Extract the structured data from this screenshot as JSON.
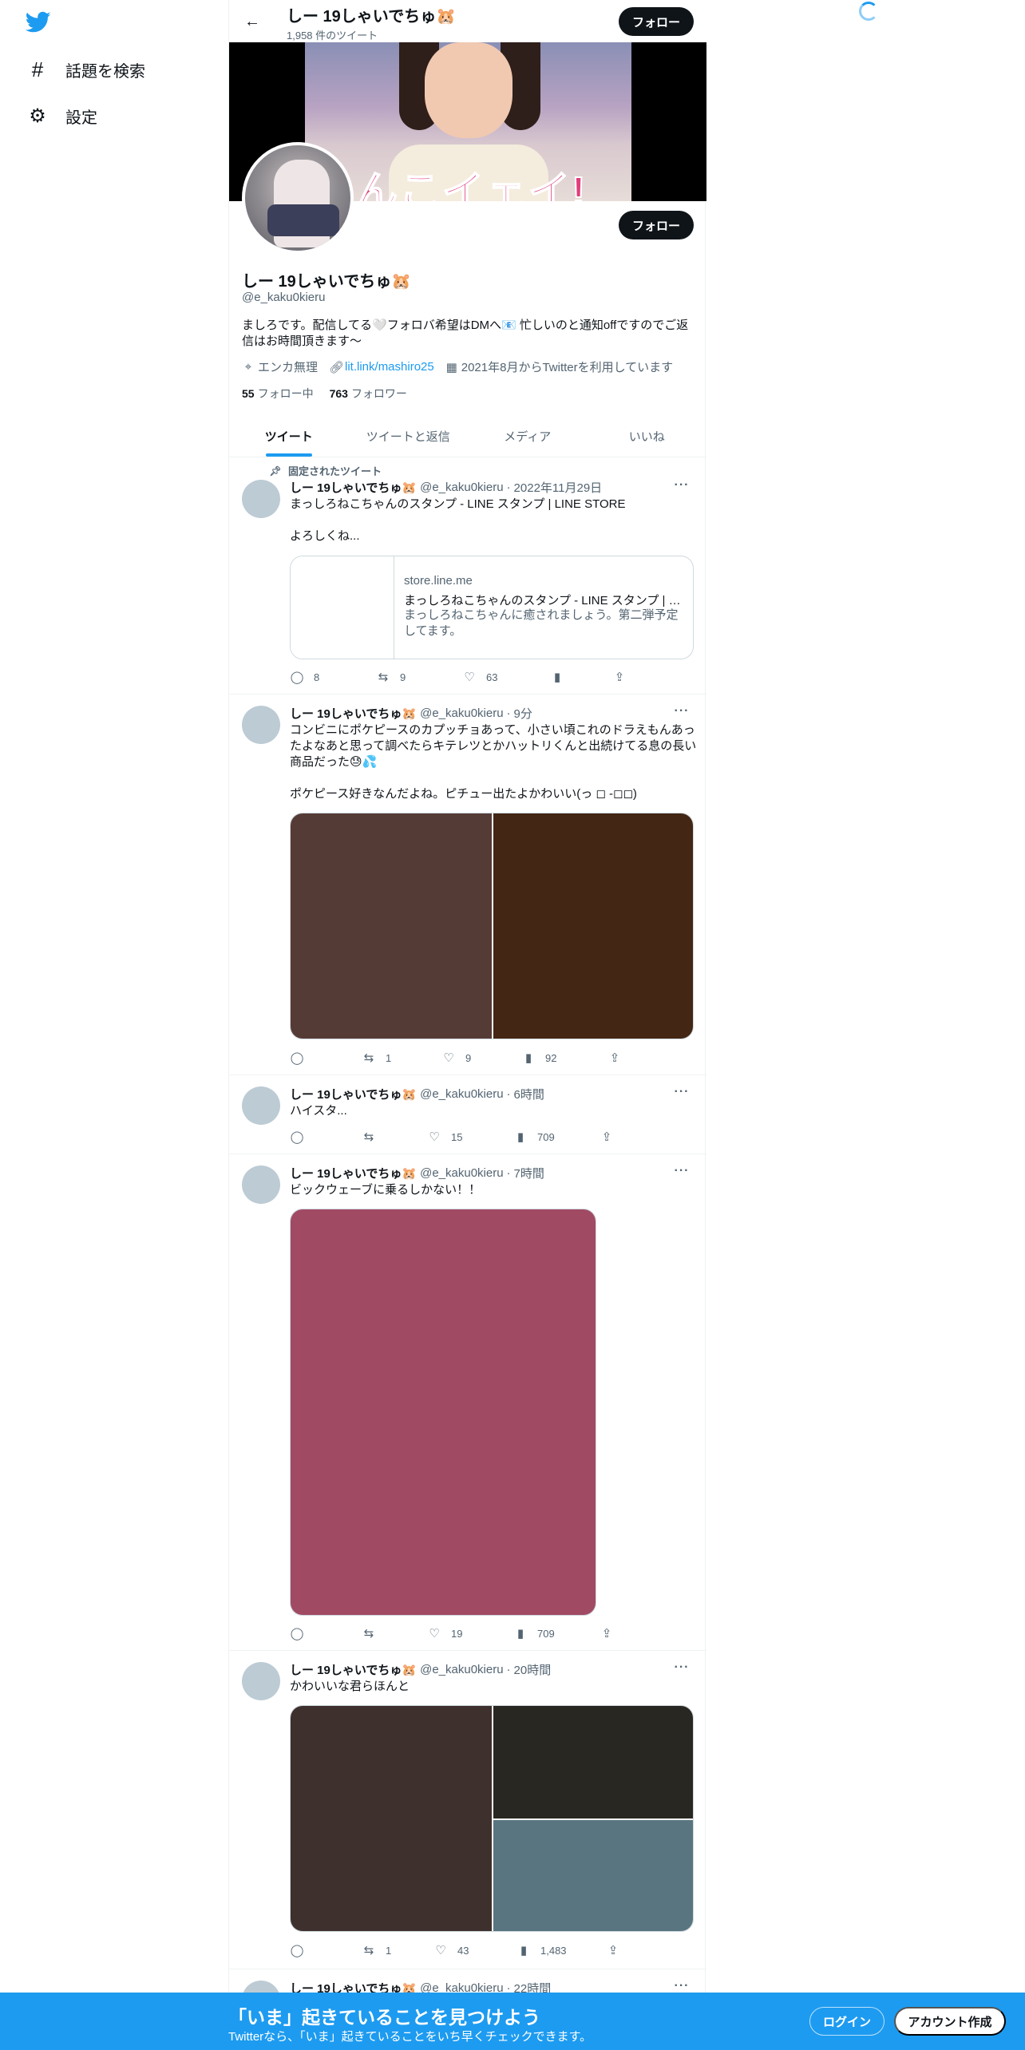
{
  "nav": {
    "items": [
      {
        "icon": "hashtag-icon",
        "glyph": "#",
        "label": "話題を検索"
      },
      {
        "icon": "gear-icon",
        "glyph": "⚙",
        "label": "設定"
      }
    ]
  },
  "header": {
    "name": "しー 19しゃいでちゅ🐹",
    "tweet_count": "1,958 件のツイート",
    "follow_label": "フォロー"
  },
  "banner": {
    "caption": "うんこイェイ!"
  },
  "profile": {
    "name": "しー 19しゃいでちゅ🐹",
    "handle": "@e_kaku0kieru",
    "bio": "ましろです。配信してる🤍フォロバ希望はDMへ📧 忙しいのと通知offですのでご返信はお時間頂きます〜",
    "location": "エンカ無理",
    "link": "lit.link/mashiro25",
    "joined": "2021年8月からTwitterを利用しています",
    "following_count": "55",
    "following_label": "フォロー中",
    "followers_count": "763",
    "followers_label": "フォロワー",
    "follow_label": "フォロー"
  },
  "tabs": [
    "ツイート",
    "ツイートと返信",
    "メディア",
    "いいね"
  ],
  "pinned_label": "固定されたツイート",
  "tweets": [
    {
      "name": "しー 19しゃいでちゅ🐹",
      "handle": "@e_kaku0kieru",
      "time": "2022年11月29日",
      "text": "まっしろねこちゃんのスタンプ - LINE スタンプ | LINE STORE\n\nよろしくね...",
      "card": {
        "domain": "store.line.me",
        "title": "まっしろねこちゃんのスタンプ - LINE スタンプ | LINE STORE",
        "desc": "まっしろねこちゃんに癒されましょう。第二弾予定してます。"
      },
      "replies": "8",
      "retweets": "9",
      "likes": "63",
      "views": ""
    },
    {
      "name": "しー 19しゃいでちゅ🐹",
      "handle": "@e_kaku0kieru",
      "time": "9分",
      "text": "コンビニにポケピースのカプッチョあって、小さい頃これのドラえもんあったよなあと思って調べたらキテレツとかハットリくんと出続けてる息の長い商品だった😓💦\n\nポケピース好きなんだよね。ピチュー出たよかわいい(っ ◻ -◻◻)",
      "media_colors": [
        "#553b35",
        "#432614"
      ],
      "replies": "",
      "retweets": "1",
      "likes": "9",
      "views": "92"
    },
    {
      "name": "しー 19しゃいでちゅ🐹",
      "handle": "@e_kaku0kieru",
      "time": "6時間",
      "text": "ハイスタ...",
      "replies": "",
      "retweets": "",
      "likes": "15",
      "views": "709"
    },
    {
      "name": "しー 19しゃいでちゅ🐹",
      "handle": "@e_kaku0kieru",
      "time": "7時間",
      "text": "ビックウェーブに乗るしかない！！",
      "media_colors": [
        "#a14a64"
      ],
      "replies": "",
      "retweets": "",
      "likes": "19",
      "views": "709"
    },
    {
      "name": "しー 19しゃいでちゅ🐹",
      "handle": "@e_kaku0kieru",
      "time": "20時間",
      "text": "かわいいな君らほんと",
      "media_colors": [
        "#3e302d",
        "#292721",
        "#587580"
      ],
      "replies": "",
      "retweets": "1",
      "likes": "43",
      "views": "1,483"
    },
    {
      "name": "しー 19しゃいでちゅ🐹",
      "handle": "@e_kaku0kieru",
      "time": "22時間"
    }
  ],
  "bottom": {
    "title": "「いま」起きていることを見つけよう",
    "subtitle": "Twitterなら、「いま」起きていることをいち早くチェックできます。",
    "login": "ログイン",
    "signup": "アカウント作成"
  },
  "colors": {
    "accent": "#1d9bf0",
    "text": "#0f1419",
    "secondary": "#536471"
  }
}
